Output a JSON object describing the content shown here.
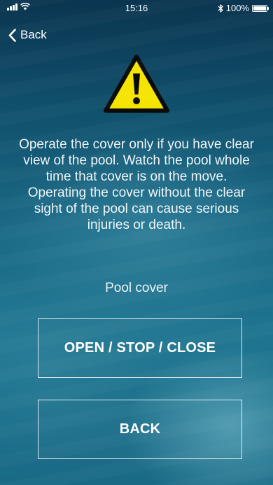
{
  "status_bar": {
    "time": "15:16",
    "bluetooth_icon": "bluetooth-icon",
    "battery_percent": "100%",
    "battery_level": 1.0,
    "signal_icon": "cellular-signal-icon",
    "wifi_icon": "wifi-icon"
  },
  "nav": {
    "back_label": "Back",
    "back_icon": "chevron-left-icon"
  },
  "warning": {
    "icon": "warning-triangle-icon",
    "icon_color": "#f5e400",
    "text": "Operate the cover only if you have clear view of the pool. Watch the pool whole time that cover is on the move. Operating the cover without the clear sight of the pool can cause serious injuries or death."
  },
  "section": {
    "label": "Pool cover"
  },
  "actions": {
    "open_stop_close_label": "OPEN / STOP / CLOSE",
    "back_label": "BACK"
  }
}
